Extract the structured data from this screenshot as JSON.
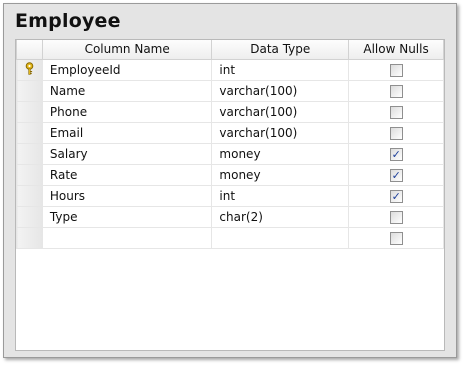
{
  "table_name": "Employee",
  "columns": {
    "col_name_header": "Column Name",
    "data_type_header": "Data Type",
    "allow_nulls_header": "Allow Nulls"
  },
  "rows": [
    {
      "name": "EmployeeId",
      "type": "int",
      "allow_nulls": false,
      "primary_key": true
    },
    {
      "name": "Name",
      "type": "varchar(100)",
      "allow_nulls": false
    },
    {
      "name": "Phone",
      "type": "varchar(100)",
      "allow_nulls": false
    },
    {
      "name": "Email",
      "type": "varchar(100)",
      "allow_nulls": false
    },
    {
      "name": "Salary",
      "type": "money",
      "allow_nulls": true
    },
    {
      "name": "Rate",
      "type": "money",
      "allow_nulls": true
    },
    {
      "name": "Hours",
      "type": "int",
      "allow_nulls": true
    },
    {
      "name": "Type",
      "type": "char(2)",
      "allow_nulls": false
    },
    {
      "name": "",
      "type": "",
      "allow_nulls": false
    }
  ],
  "icons": {
    "primary_key": "key-icon"
  },
  "colors": {
    "check": "#1d3f9a",
    "key": "#e3b71a"
  }
}
